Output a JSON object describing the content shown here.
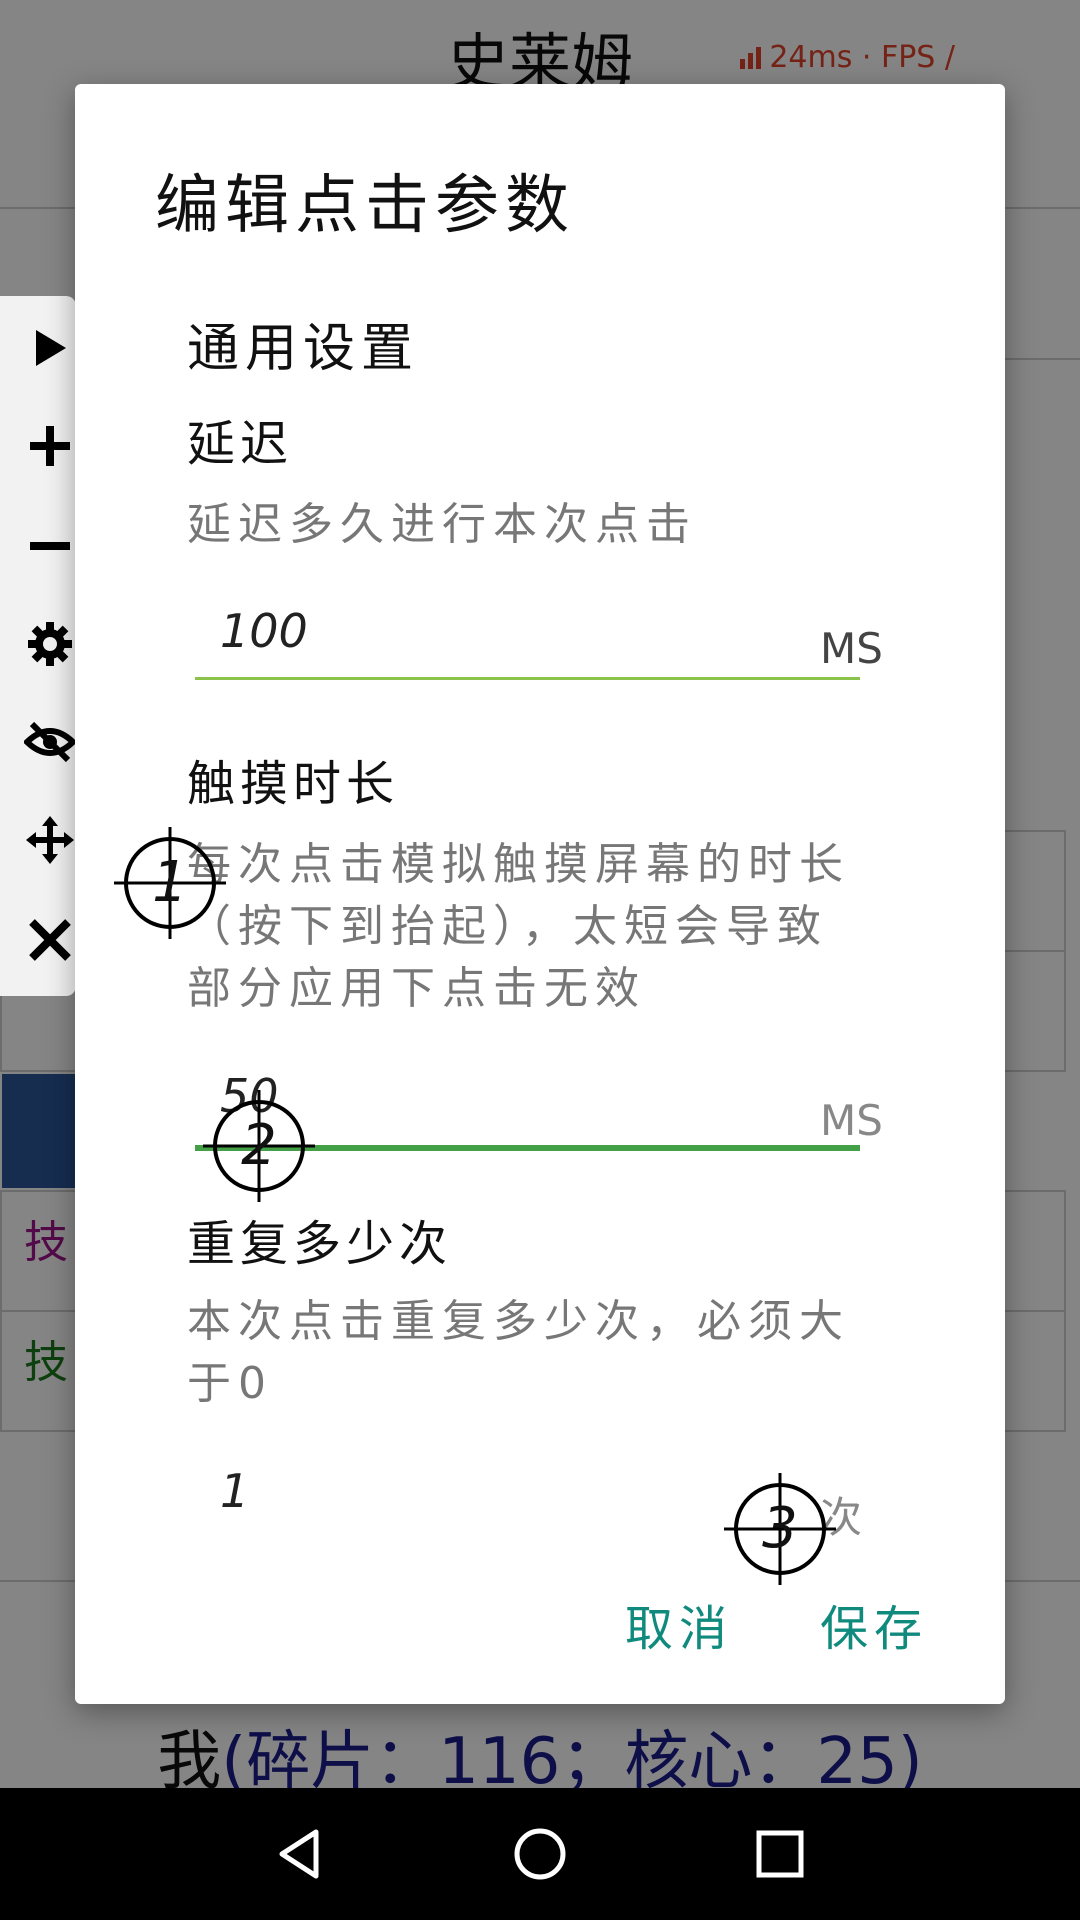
{
  "app": {
    "title": "史莱姆",
    "perf": "24ms · FPS /",
    "tags": [
      "技",
      "技"
    ],
    "bottom_me": "我",
    "bottom_rest": "(碎片：116；核心：25)"
  },
  "dialog": {
    "title": "编辑点击参数",
    "section": "通用设置",
    "delay": {
      "label": "延迟",
      "desc": "延迟多久进行本次点击",
      "value": "100",
      "unit": "MS"
    },
    "touch": {
      "label": "触摸时长",
      "desc": "每次点击模拟触摸屏幕的时长（按下到抬起），太短会导致部分应用下点击无效",
      "value": "50",
      "unit": "MS"
    },
    "repeat": {
      "label": "重复多少次",
      "desc": "本次点击重复多少次，必须大于0",
      "value": "1",
      "unit": "次"
    },
    "cancel": "取消",
    "save": "保存"
  },
  "targets": [
    "1",
    "2",
    "3"
  ],
  "colors": {
    "accent": "#0f8a7d",
    "underline_idle": "#8bc34a",
    "underline_focus": "#43a047",
    "app_blue": "#1b1e8c"
  },
  "icons": {
    "toolbar": [
      "play-icon",
      "plus-icon",
      "minus-icon",
      "gear-icon",
      "eye-off-icon",
      "move-icon",
      "close-icon"
    ],
    "nav": [
      "back-icon",
      "home-icon",
      "recents-icon"
    ]
  }
}
